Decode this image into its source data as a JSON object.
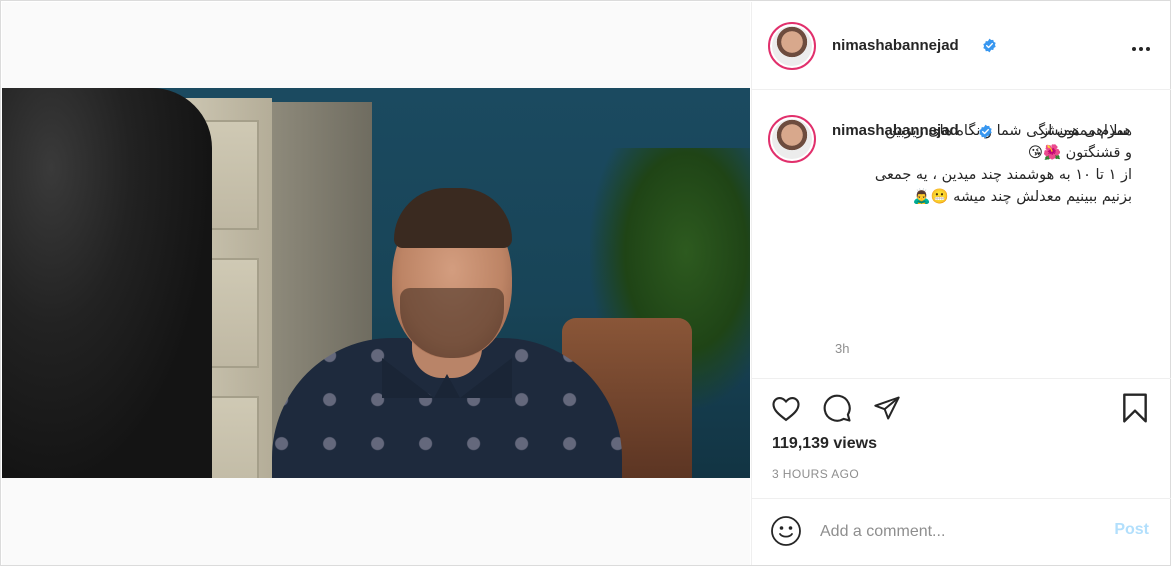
{
  "post": {
    "username": "nimashabannejad",
    "verified": true,
    "caption_lines": [
      "سلام ممنون از",
      "همراهی همیشگی شما و نگاه های ریزبین",
      "و قشنگتون 🌺😘",
      "از ۱ تا ۱۰ به هوشمند چند میدین ، یه جمعی",
      "بزنیم ببینیم معدلش چند میشه 😬🙇‍♂️"
    ],
    "caption_time": "3h",
    "views": "119,139 views",
    "timestamp": "3 HOURS AGO"
  },
  "icons": {
    "more": "more-options-icon",
    "like": "heart-icon",
    "comment": "comment-icon",
    "share": "send-icon",
    "save": "bookmark-icon",
    "mute": "speaker-muted-icon",
    "emoji": "smiley-icon",
    "verified": "verified-badge-icon"
  },
  "comment_box": {
    "placeholder": "Add a comment...",
    "post_label": "Post"
  },
  "colors": {
    "verified": "#3897f0",
    "post_disabled": "#b2dffc",
    "avatar_ring": "#e1306c"
  }
}
